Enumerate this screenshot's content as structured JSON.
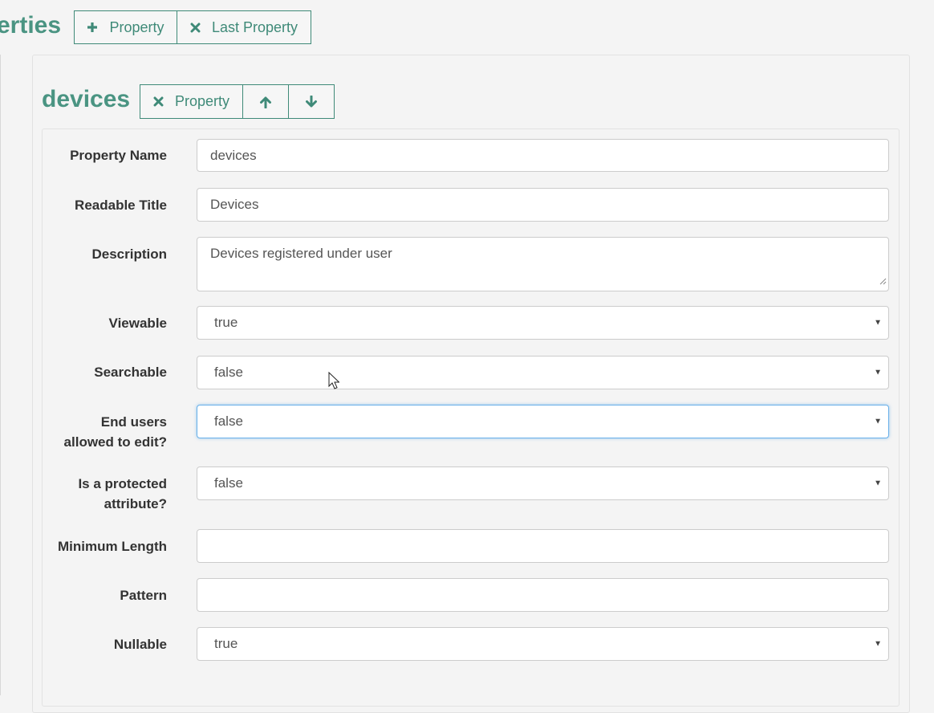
{
  "header": {
    "section_title": "erties",
    "add_property_label": "Property",
    "remove_last_property_label": "Last Property",
    "add_icon": "plus-icon",
    "remove_icon": "x-icon"
  },
  "property": {
    "title": "devices",
    "remove_property_label": "Property",
    "remove_icon": "x-icon",
    "move_up_icon": "arrow-up-icon",
    "move_down_icon": "arrow-down-icon"
  },
  "form": {
    "property_name": {
      "label": "Property Name",
      "value": "devices"
    },
    "readable_title": {
      "label": "Readable Title",
      "value": "Devices"
    },
    "description": {
      "label": "Description",
      "value": "Devices registered under user"
    },
    "viewable": {
      "label": "Viewable",
      "value": "true"
    },
    "searchable": {
      "label": "Searchable",
      "value": "false"
    },
    "end_users_edit": {
      "label_line1": "End users",
      "label_line2": "allowed to edit?",
      "value": "false"
    },
    "protected_attribute": {
      "label_line1": "Is a protected",
      "label_line2": "attribute?",
      "value": "false"
    },
    "minimum_length": {
      "label": "Minimum Length",
      "value": ""
    },
    "pattern": {
      "label": "Pattern",
      "value": ""
    },
    "nullable": {
      "label": "Nullable",
      "value": "true"
    }
  },
  "colors": {
    "accent": "#4a9482",
    "button_border": "#3f8a78",
    "focus_border": "#66afe9",
    "background": "#f4f4f4"
  }
}
